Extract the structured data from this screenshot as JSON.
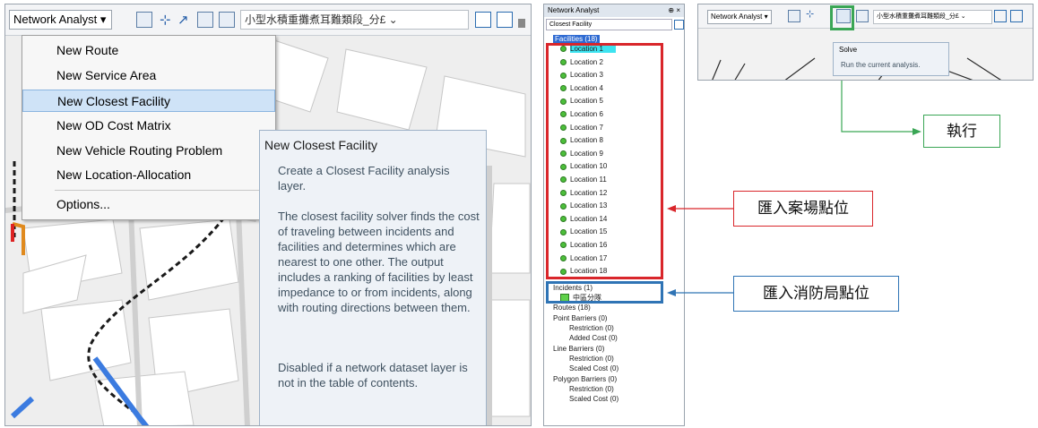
{
  "left": {
    "toolbar": {
      "dropdown_label": "Network Analyst ▾",
      "layer_select": "小型水積重攤煮耳難類段_分£ ⌄"
    },
    "menu": {
      "items": [
        {
          "label": "New Route"
        },
        {
          "label": "New Service Area"
        },
        {
          "label": "New Closest Facility"
        },
        {
          "label": "New OD Cost Matrix"
        },
        {
          "label": "New Vehicle Routing Problem"
        },
        {
          "label": "New Location-Allocation"
        },
        {
          "label": "Options..."
        }
      ]
    },
    "tooltip": {
      "title": "New Closest Facility",
      "p1": "Create a Closest Facility analysis layer.",
      "p2": "The closest facility solver finds the cost of traveling between incidents and facilities and determines which are nearest to one other. The output includes a ranking of facilities by least impedance to or from incidents, along with routing directions between them.",
      "p3": "Disabled if a network dataset layer is not in the table of contents."
    }
  },
  "middle": {
    "title": "Network Analyst",
    "pin": "⊕ ×",
    "layer": "Closest Facility",
    "facilities_header": "Facilities (18)",
    "locations": [
      "Location 1",
      "Location 2",
      "Location 3",
      "Location 4",
      "Location 5",
      "Location 6",
      "Location 7",
      "Location 8",
      "Location 9",
      "Location 10",
      "Location 11",
      "Location 12",
      "Location 13",
      "Location 14",
      "Location 15",
      "Location 16",
      "Location 17",
      "Location 18"
    ],
    "incidents_header": "Incidents (1)",
    "incident_item": "中區分隊",
    "routes": "Routes (18)",
    "point_barriers": "Point Barriers (0)",
    "pb_restriction": "Restriction (0)",
    "pb_added": "Added Cost (0)",
    "line_barriers": "Line Barriers (0)",
    "lb_restriction": "Restriction (0)",
    "lb_scaled": "Scaled Cost (0)",
    "polygon_barriers": "Polygon Barriers (0)",
    "pg_restriction": "Restriction (0)",
    "pg_scaled": "Scaled Cost (0)"
  },
  "right": {
    "toolbar_dropdown": "Network Analyst ▾",
    "toolbar_layer": "小型水積重攤煮耳難類段_分£ ⌄",
    "solve_title": "Solve",
    "solve_desc": "Run the current analysis."
  },
  "annotations": {
    "execute": "執行",
    "import_sites": "匯入案場點位",
    "import_fire": "匯入消防局點位"
  },
  "colors": {
    "red_box": "#d9262b",
    "blue_box": "#2f74b5",
    "green_box": "#3aa655",
    "highlight": "#3de3f0"
  }
}
